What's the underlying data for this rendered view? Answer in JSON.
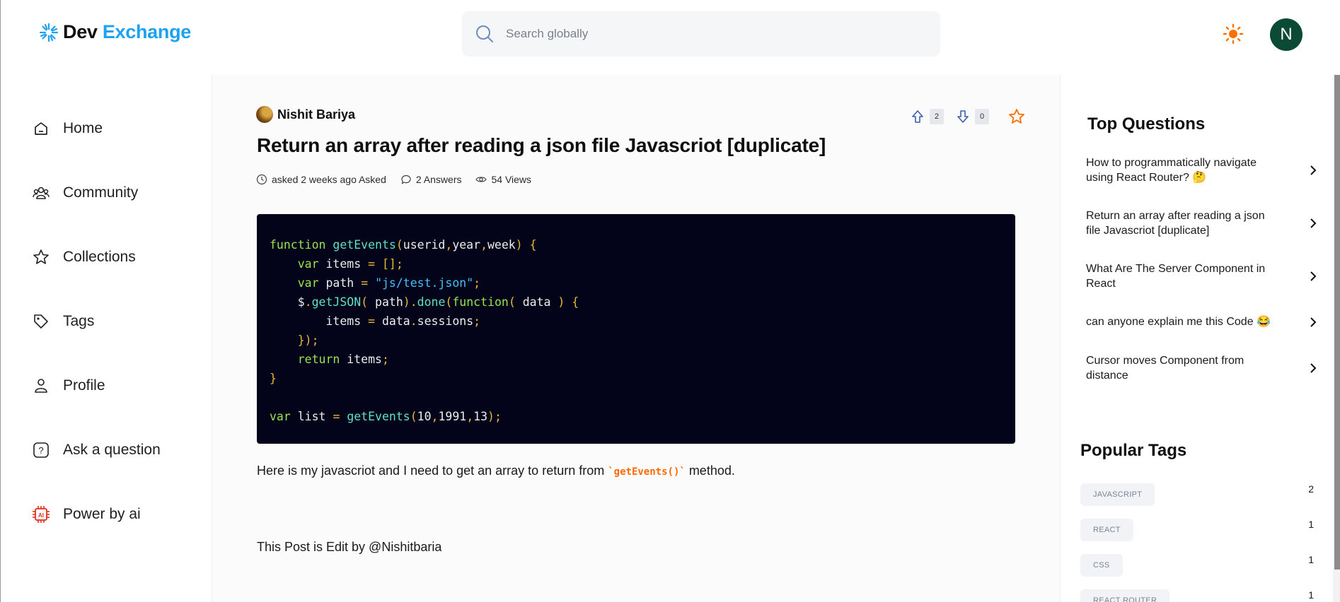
{
  "header": {
    "logo_dev": "Dev",
    "logo_exchange": "Exchange",
    "search_placeholder": "Search globally",
    "avatar_initial": "N"
  },
  "sidebar": {
    "items": [
      {
        "label": "Home",
        "icon": "home-icon"
      },
      {
        "label": "Community",
        "icon": "users-icon"
      },
      {
        "label": "Collections",
        "icon": "star-icon"
      },
      {
        "label": "Tags",
        "icon": "tag-icon"
      },
      {
        "label": "Profile",
        "icon": "user-icon"
      },
      {
        "label": "Ask a question",
        "icon": "question-icon"
      },
      {
        "label": "Power by ai",
        "icon": "ai-chip-icon"
      }
    ]
  },
  "question": {
    "author": "Nishit Bariya",
    "upvotes": "2",
    "downvotes": "0",
    "title": "Return an array after reading a json file Javascriot [duplicate]",
    "asked": "asked 2 weeks ago Asked",
    "answers": "2 Answers",
    "views": "54 Views",
    "body_before": "Here is my javascriot and I need to get an array to return from ",
    "inline_code": "`getEvents()`",
    "body_after": " method.",
    "edit_note": "This Post is Edit by @Nishitbaria"
  },
  "top_questions": {
    "title": "Top Questions",
    "items": [
      "How to programmatically navigate using React Router? 🤔",
      "Return an array after reading a json file Javascriot [duplicate]",
      "What Are The Server Component in React",
      "can anyone explain me this Code 😂",
      "Cursor moves Component from distance"
    ]
  },
  "popular_tags": {
    "title": "Popular Tags",
    "items": [
      {
        "name": "JAVASCRIPT",
        "count": "2"
      },
      {
        "name": "REACT",
        "count": "1"
      },
      {
        "name": "CSS",
        "count": "1"
      },
      {
        "name": "REACT ROUTER",
        "count": "1"
      }
    ]
  },
  "colors": {
    "accent_blue": "#1da1f2",
    "accent_orange": "#ff7000",
    "avatar_bg": "#0b4a35",
    "code_bg": "#03031a"
  }
}
